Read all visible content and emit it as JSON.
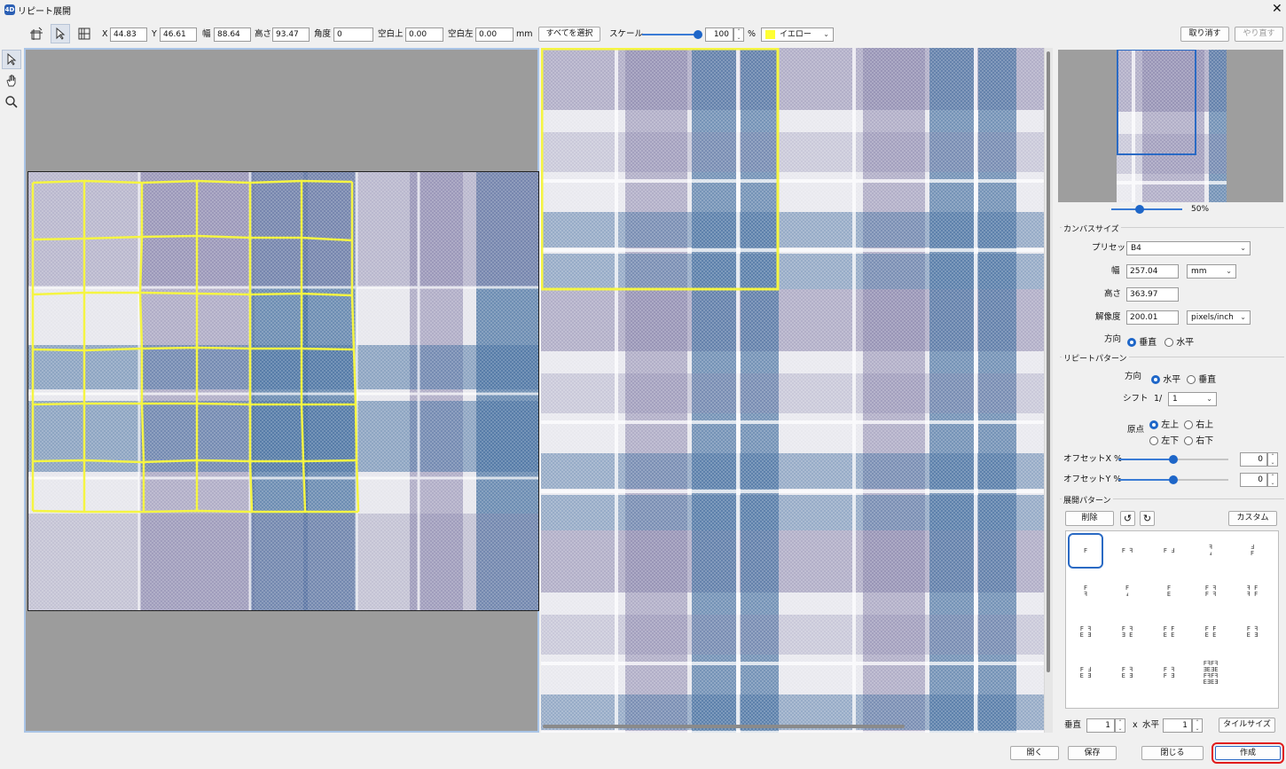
{
  "window": {
    "title": "リピート展開",
    "close": "✕",
    "icon_text": "4D"
  },
  "toolbar": {
    "x_label": "X",
    "x": "44.83",
    "y_label": "Y",
    "y": "46.61",
    "w_label": "幅",
    "w": "88.64",
    "h_label": "高さ",
    "h": "93.47",
    "angle_label": "角度",
    "angle": "0",
    "margin_top_label": "空白上",
    "margin_top": "0.00",
    "margin_left_label": "空白左",
    "margin_left": "0.00",
    "unit": "mm",
    "select_all": "すべてを選択",
    "scale_label": "スケール",
    "scale_value": "100",
    "scale_percent": "%",
    "scale_level": 0.95,
    "color_name": "イエロー",
    "color_hex": "#ffff33",
    "undo": "取り消す",
    "redo": "やり直す"
  },
  "preview": {
    "zoom": "50%",
    "zoom_level": 0.4
  },
  "canvas_size": {
    "title": "カンバスサイズ",
    "preset_label": "プリセット",
    "preset": "B4",
    "width_label": "幅",
    "width": "257.04",
    "width_unit": "mm",
    "height_label": "高さ",
    "height": "363.97",
    "res_label": "解像度",
    "res": "200.01",
    "res_unit": "pixels/inch",
    "dir_label": "方向",
    "dir_v": "垂直",
    "dir_h": "水平"
  },
  "repeat": {
    "title": "リピートパターン",
    "dir_label": "方向",
    "dir_h": "水平",
    "dir_v": "垂直",
    "shift_label": "シフト",
    "shift_prefix": "1/",
    "shift": "1",
    "origin_label": "原点",
    "tl": "左上",
    "tr": "右上",
    "bl": "左下",
    "br": "右下",
    "offx_label": "オフセットX %",
    "offx": "0",
    "offx_level": 0.5,
    "offy_label": "オフセットY %",
    "offy": "0",
    "offy_level": 0.5
  },
  "layout": {
    "title": "展開パターン",
    "delete": "削除",
    "custom": "カスタム",
    "patterns": [
      "F",
      "F ꟻ",
      "F Ⅎ",
      "ꟻ\nⅎ",
      "Ⅎ\nF",
      "F\nꟻ",
      "F\nⅎ",
      "F\nE",
      "F ꟻ\nF ꟻ",
      "ꟻ F\nꟻ F",
      "F ꟻ\nE Ǝ",
      "F ꟻ\nƎ E",
      "F F\nE E",
      "F F\nE E",
      "F ꟻ\nE Ǝ",
      "F Ⅎ\nE Ǝ",
      "F ꟻ\nE Ǝ",
      "F ꟻ\nF Ǝ",
      "FꟻFꟻ\nƎEƎE\nFꟻFꟻ\nEƎEƎ"
    ],
    "v_label": "垂直",
    "v": "1",
    "x_sep": "x",
    "h_label": "水平",
    "h": "1",
    "tile_size": "タイルサイズ"
  },
  "footer": {
    "open": "開く",
    "save": "保存",
    "close": "閉じる",
    "create": "作成"
  }
}
